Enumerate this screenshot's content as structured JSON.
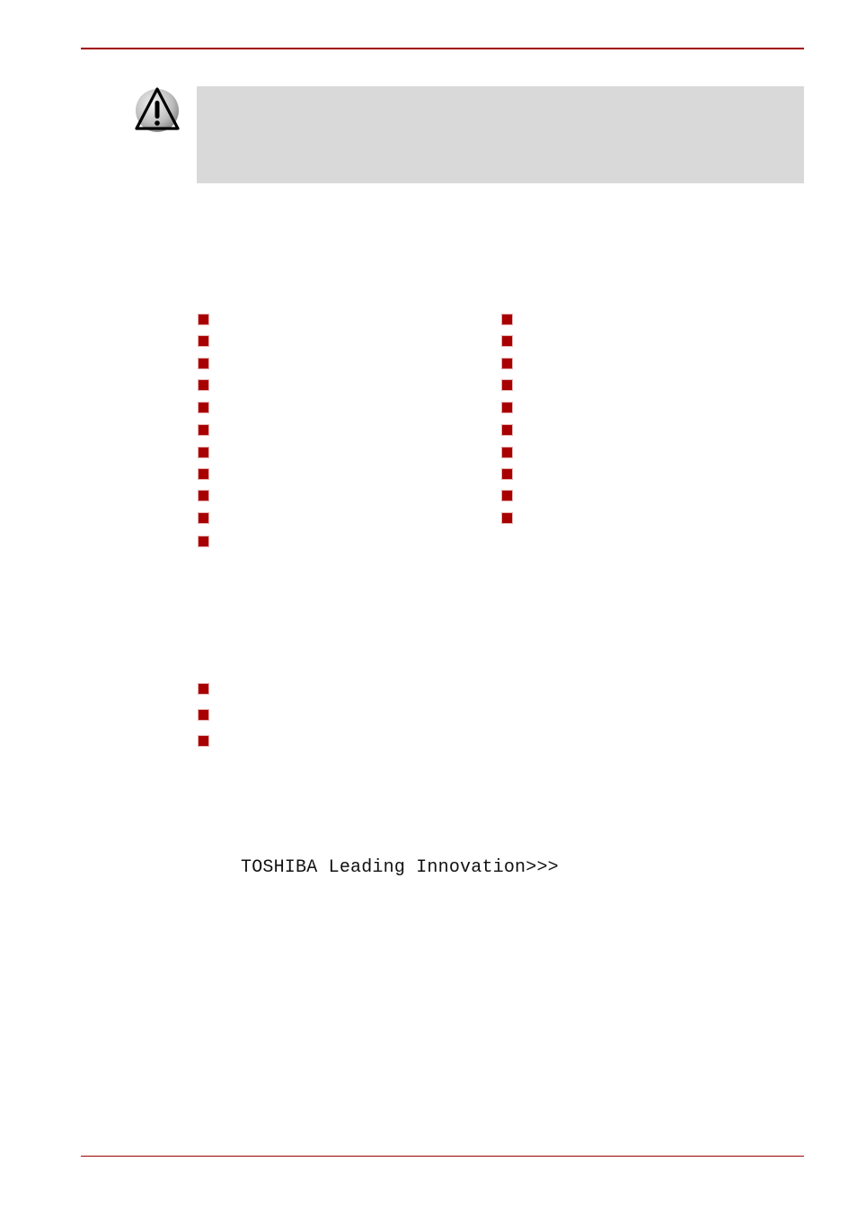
{
  "header": {
    "rule_color": "#a00000"
  },
  "warning_callout": {
    "icon": "warning-triangle-icon",
    "text": "",
    "background": "#d9d9d9"
  },
  "list_left": {
    "item_count": 11,
    "items": [
      "",
      "",
      "",
      "",
      "",
      "",
      "",
      "",
      "",
      "",
      ""
    ]
  },
  "list_right": {
    "item_count": 10,
    "items": [
      "",
      "",
      "",
      "",
      "",
      "",
      "",
      "",
      "",
      ""
    ]
  },
  "list_lower": {
    "item_count": 3,
    "items": [
      "",
      "",
      ""
    ]
  },
  "bullet_color": "#a80000",
  "tagline": "TOSHIBA Leading Innovation>>>",
  "footer": {
    "rule_color": "#a00000"
  }
}
